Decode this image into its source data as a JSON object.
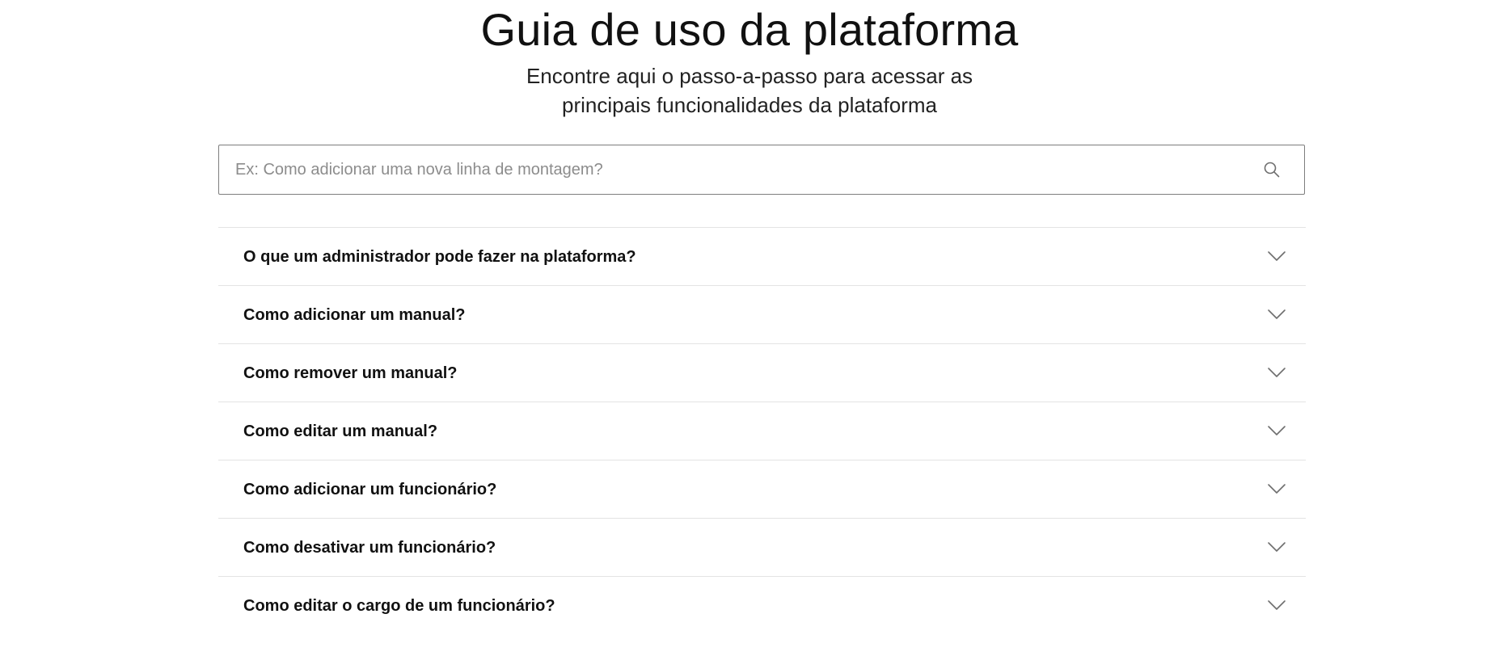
{
  "header": {
    "title": "Guia de uso da plataforma",
    "subtitle": "Encontre aqui o passo-a-passo para acessar as principais funcionalidades da plataforma"
  },
  "search": {
    "placeholder": "Ex: Como adicionar uma nova linha de montagem?",
    "value": "",
    "icon": "search-icon"
  },
  "faq": {
    "items": [
      {
        "question": "O que um administrador pode fazer na plataforma?",
        "icon": "chevron-down-icon"
      },
      {
        "question": "Como adicionar um manual?",
        "icon": "chevron-down-icon"
      },
      {
        "question": "Como remover um manual?",
        "icon": "chevron-down-icon"
      },
      {
        "question": "Como editar um manual?",
        "icon": "chevron-down-icon"
      },
      {
        "question": "Como adicionar um funcionário?",
        "icon": "chevron-down-icon"
      },
      {
        "question": "Como desativar um funcionário?",
        "icon": "chevron-down-icon"
      },
      {
        "question": "Como editar o cargo de um funcionário?",
        "icon": "chevron-down-icon"
      }
    ]
  },
  "colors": {
    "text": "#111111",
    "divider": "#e3e3e3",
    "search_border": "#7d7d7d",
    "placeholder": "#8c8c8c",
    "icon": "#6e6e6e"
  }
}
